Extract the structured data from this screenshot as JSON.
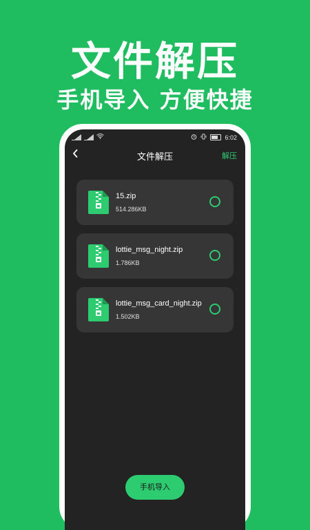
{
  "hero": {
    "title": "文件解压",
    "subtitle": "手机导入 方便快捷"
  },
  "status_bar": {
    "time": "6:02"
  },
  "header": {
    "back_icon": "chevron-left-icon",
    "title": "文件解压",
    "action_label": "解压"
  },
  "files": [
    {
      "name": "15.zip",
      "size": "514.286KB",
      "selected": false
    },
    {
      "name": "lottie_msg_night.zip",
      "size": "1.786KB",
      "selected": false
    },
    {
      "name": "lottie_msg_card_night.zip",
      "size": "1.502KB",
      "selected": false
    }
  ],
  "footer": {
    "import_label": "手机导入"
  },
  "colors": {
    "background": "#1fbd5f",
    "accent": "#2ecc71",
    "screen": "#232323",
    "card": "#363636"
  }
}
